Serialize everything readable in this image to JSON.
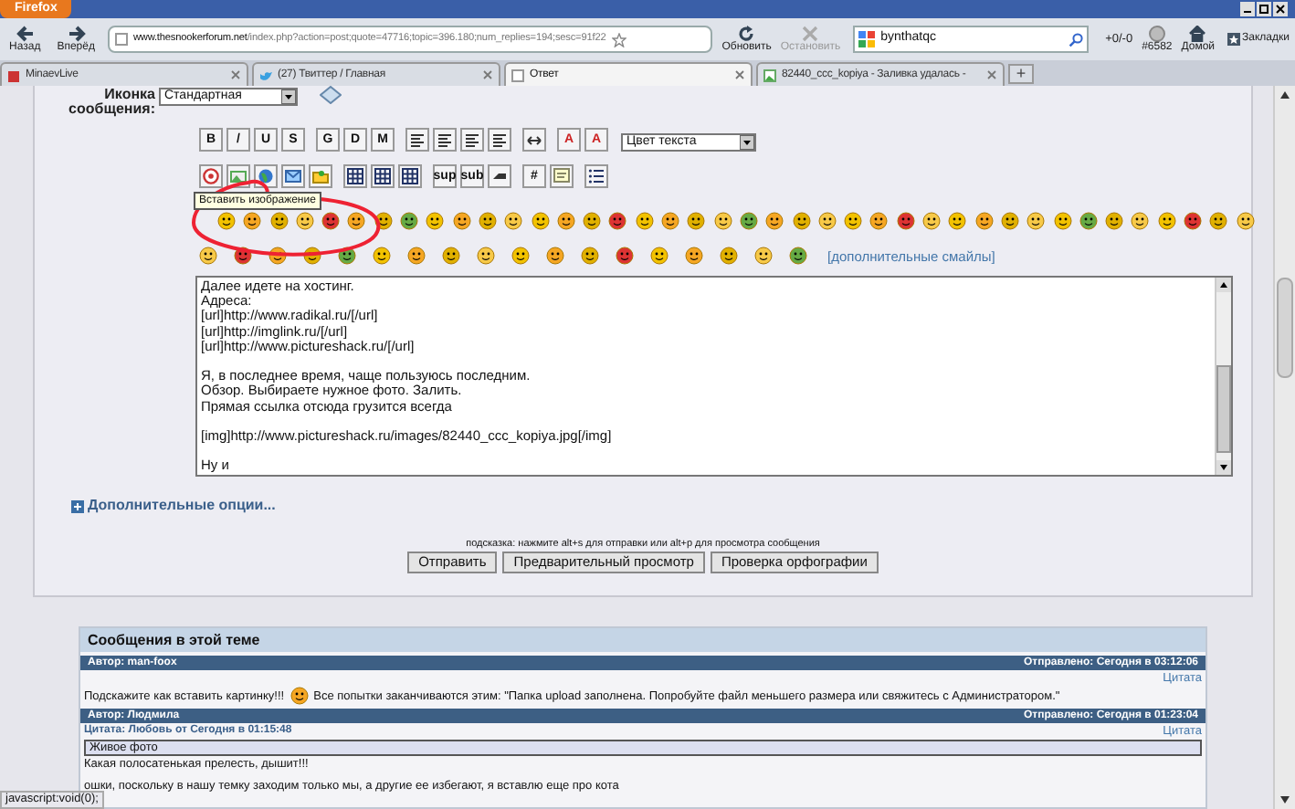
{
  "browser": {
    "app_button": "Firefox",
    "nav": [
      {
        "label": "Назад",
        "kind": "back"
      },
      {
        "label": "Вперёд",
        "kind": "forward"
      }
    ],
    "address": {
      "domain": "www.thesnookerforum.net",
      "path": "/index.php?action=post;quote=47716;topic=396.180;num_replies=194;sesc=91f22"
    },
    "actions": [
      {
        "label": "Обновить",
        "kind": "reload",
        "disabled": false
      },
      {
        "label": "Остановить",
        "kind": "stop",
        "disabled": true
      }
    ],
    "search": {
      "value": "bynthatqc"
    },
    "addon": {
      "label": "+0/-0"
    },
    "counter": {
      "label": "#6582"
    },
    "home": {
      "label": "Домой"
    },
    "bookmarks": {
      "label": "Закладки"
    },
    "tabs": [
      {
        "label": "MinaevLive",
        "selected": false,
        "kind": "red"
      },
      {
        "label": "(27) Твиттер / Главная",
        "selected": false,
        "kind": "bird"
      },
      {
        "label": "Ответ",
        "selected": true,
        "kind": "blank"
      },
      {
        "label": "82440_ccc_kopiya - Заливка удалась -",
        "selected": false,
        "kind": "image"
      }
    ],
    "new_tab": "+"
  },
  "form": {
    "icon_label": "Иконка сообщения:",
    "icon_select": "Стандартная",
    "toolbar_1": [
      {
        "kind": "text",
        "label": "B"
      },
      {
        "kind": "text",
        "label": "/"
      },
      {
        "kind": "text",
        "label": "U"
      },
      {
        "kind": "text",
        "label": "S"
      },
      {
        "kind": "sep"
      },
      {
        "kind": "text",
        "label": "G"
      },
      {
        "kind": "text",
        "label": "D"
      },
      {
        "kind": "text",
        "label": "M"
      },
      {
        "kind": "sep"
      },
      {
        "kind": "align"
      },
      {
        "kind": "align"
      },
      {
        "kind": "align"
      },
      {
        "kind": "align"
      },
      {
        "kind": "sep"
      },
      {
        "kind": "rule"
      },
      {
        "kind": "sep"
      },
      {
        "kind": "text",
        "label": "A"
      },
      {
        "kind": "text",
        "label": "A"
      }
    ],
    "color_select": "Цвет текста",
    "toolbar_2": [
      {
        "kind": "flash"
      },
      {
        "kind": "image"
      },
      {
        "kind": "globe"
      },
      {
        "kind": "mail"
      },
      {
        "kind": "folder"
      },
      {
        "kind": "sep"
      },
      {
        "kind": "table"
      },
      {
        "kind": "table"
      },
      {
        "kind": "table"
      },
      {
        "kind": "sep"
      },
      {
        "kind": "text",
        "label": "sup"
      },
      {
        "kind": "text",
        "label": "sub"
      },
      {
        "kind": "tele"
      },
      {
        "kind": "sep"
      },
      {
        "kind": "text",
        "label": "#"
      },
      {
        "kind": "quote"
      },
      {
        "kind": "sep"
      },
      {
        "kind": "list"
      }
    ],
    "tooltip": "Вставить изображение",
    "more_smileys": "[дополнительные смайлы]",
    "message": [
      [
        "Далее идете на хостинг.",
        "Адреса:",
        "[url]http://www.radikal.ru/[/url]",
        "[url]http://imglink.ru/[/url]",
        "[url]http://www.pictureshack.ru/[/url]"
      ],
      [
        "Я, в последнее время, чаще пользуюсь последним.",
        "Обзор. Выбираете нужное фото. Залить.",
        "Прямая ссылка отсюда грузится всегда"
      ],
      [
        "[img]http://www.pictureshack.ru/images/82440_ccc_kopiya.jpg[/img]"
      ],
      [
        "Ну и"
      ]
    ],
    "more_options": "Дополнительные опции...",
    "hint": "подсказка: нажмите alt+s для отправки или alt+p для просмотра сообщения",
    "buttons": [
      "Отправить",
      "Предварительный просмотр",
      "Проверка орфографии"
    ]
  },
  "topic": {
    "title": "Сообщения в этой теме",
    "posts": [
      {
        "author": "Автор: man-foox",
        "date": "Отправлено: Сегодня в 03:12:06",
        "quote_link": "Цитата",
        "body_before": "Подскажите как вставить картинку!!!",
        "body_after": "Все попытки заканчиваются этим: \"Папка upload заполнена. Попробуйте файл меньшего размера или свяжитесь с Администратором.\""
      },
      {
        "author": "Автор: Людмила",
        "date": "Отправлено: Сегодня в 01:23:04",
        "quote_link": "Цитата",
        "quote_header": "Цитата: Любовь от Сегодня в 01:15:48",
        "quote_body": "Живое фото",
        "body_before": "Какая полосатенькая прелесть, дышит!!!",
        "body_next": "ошки, поскольку в нашу темку заходим только мы, а другие ее избегают, я вставлю еще про кота"
      }
    ]
  },
  "status_bar": "javascript:void(0);"
}
